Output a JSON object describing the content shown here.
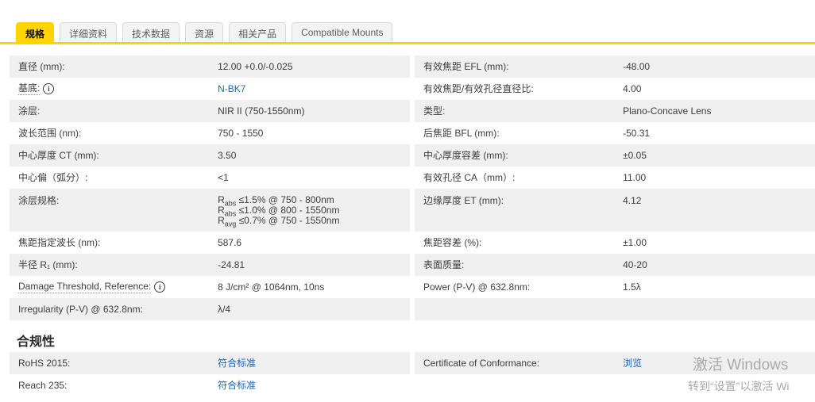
{
  "colors": {
    "accent_yellow": "#ffd400",
    "link_blue": "#1d66b8",
    "row_shaded": "#efefef"
  },
  "tabs": [
    {
      "label": "规格",
      "active": true
    },
    {
      "label": "详细资料",
      "active": false
    },
    {
      "label": "技术数据",
      "active": false
    },
    {
      "label": "资源",
      "active": false
    },
    {
      "label": "相关产品",
      "active": false
    },
    {
      "label": "Compatible Mounts",
      "active": false
    }
  ],
  "spec_table": {
    "left_rows": [
      {
        "label": "直径 (mm):",
        "value": "12.00 +0.0/-0.025",
        "shaded": true
      },
      {
        "label": "基底:",
        "info": true,
        "dotted": true,
        "value": "N-BK7",
        "link": true
      },
      {
        "label": "涂层:",
        "value": "NIR II (750-1550nm)",
        "shaded": true
      },
      {
        "label": "波长范围 (nm):",
        "value": "750 - 1550"
      },
      {
        "label": "中心厚度 CT (mm):",
        "value": "3.50",
        "shaded": true
      },
      {
        "label": "中心偏（弧分）:",
        "value": "<1"
      },
      {
        "label": "涂层规格:",
        "shaded": true,
        "tall": true,
        "lines": [
          [
            {
              "t": "R"
            },
            {
              "t": "abs",
              "sub": true
            },
            {
              "t": " ≤1.5% @ 750 - 800nm"
            }
          ],
          [
            {
              "t": "R"
            },
            {
              "t": "abs",
              "sub": true
            },
            {
              "t": " ≤1.0% @ 800 - 1550nm"
            }
          ],
          [
            {
              "t": "R"
            },
            {
              "t": "avg",
              "sub": true
            },
            {
              "t": " ≤0.7% @ 750 - 1550nm"
            }
          ]
        ]
      },
      {
        "label": "焦距指定波长 (nm):",
        "value": "587.6"
      },
      {
        "label": "半径 R₁ (mm):",
        "value": "-24.81",
        "shaded": true
      },
      {
        "label": "Damage Threshold, Reference:",
        "info": true,
        "dotted": true,
        "value": "8 J/cm² @ 1064nm, 10ns"
      },
      {
        "label": "Irregularity (P-V) @ 632.8nm:",
        "value": "λ/4",
        "shaded": true
      }
    ],
    "right_rows": [
      {
        "label": "有效焦距 EFL (mm):",
        "value": "-48.00",
        "shaded": true
      },
      {
        "label": "有效焦距/有效孔径直径比:",
        "value": "4.00"
      },
      {
        "label": "类型:",
        "value": "Plano-Concave Lens",
        "shaded": true
      },
      {
        "label": "后焦距 BFL (mm):",
        "value": "-50.31"
      },
      {
        "label": "中心厚度容差 (mm):",
        "value": "±0.05",
        "shaded": true
      },
      {
        "label": "有效孔径 CA（mm）:",
        "value": "11.00"
      },
      {
        "label": "边缘厚度 ET (mm):",
        "value": "4.12",
        "shaded": true,
        "tall": true
      },
      {
        "label": "焦距容差 (%):",
        "value": "±1.00"
      },
      {
        "label": "表面质量:",
        "value": "40-20",
        "shaded": true
      },
      {
        "label": "Power (P-V) @ 632.8nm:",
        "value": "1.5λ"
      },
      {
        "label": "",
        "value": "",
        "shaded": true
      }
    ]
  },
  "compliance": {
    "heading": "合规性",
    "left_rows": [
      {
        "label": "RoHS 2015:",
        "value": "符合标准",
        "link": true,
        "shaded": true
      },
      {
        "label": "Reach 235:",
        "value": "符合标准",
        "link": true
      }
    ],
    "right_rows": [
      {
        "label": "Certificate of Conformance:",
        "value": "浏览",
        "link": true,
        "shaded": true
      }
    ]
  },
  "watermark": {
    "line1": "激活 Windows",
    "line2": "转到“设置”以激活 Wi"
  }
}
